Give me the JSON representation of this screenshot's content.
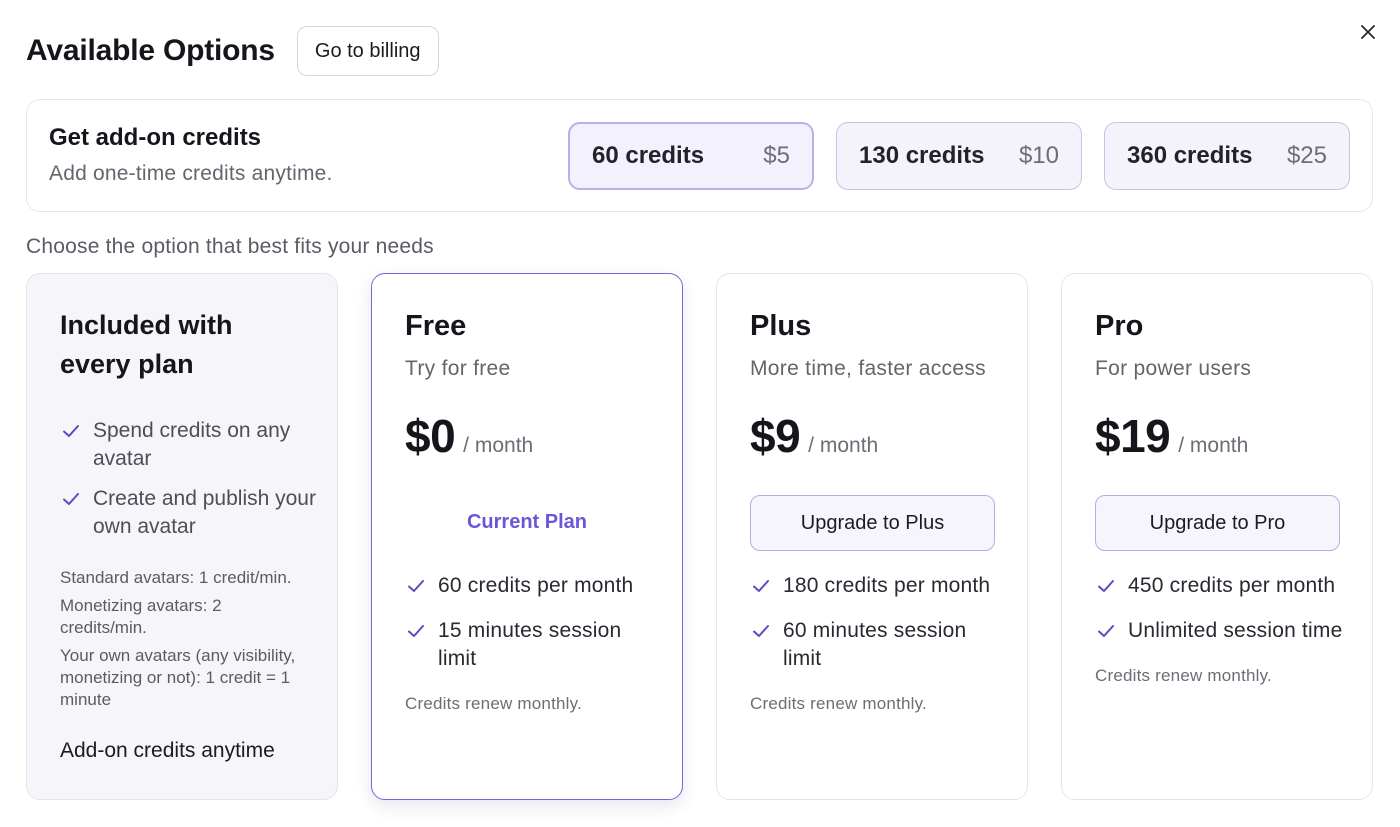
{
  "header": {
    "title": "Available Options",
    "billing_label": "Go to billing",
    "close_icon": "close-icon"
  },
  "addon": {
    "title": "Get add-on credits",
    "subtitle": "Add one-time credits anytime.",
    "options": [
      {
        "credits": "60 credits",
        "price": "$5",
        "selected": true
      },
      {
        "credits": "130 credits",
        "price": "$10",
        "selected": false
      },
      {
        "credits": "360 credits",
        "price": "$25",
        "selected": false
      }
    ]
  },
  "choose_label": "Choose the option that best fits your needs",
  "included": {
    "title": "Included with every plan",
    "items": [
      "Spend credits on any avatar",
      "Create and publish your own avatar"
    ],
    "fine_print": [
      "Standard avatars: 1 credit/min.",
      "Monetizing avatars: 2 credits/min.",
      "Your own avatars (any visibility, monetizing or not): 1 credit = 1 minute"
    ],
    "addon_label": "Add-on credits anytime"
  },
  "plans": [
    {
      "name": "Free",
      "tagline": "Try for free",
      "price": "$0",
      "period": "/ month",
      "action": "Current Plan",
      "current": true,
      "features": [
        "60 credits per month",
        "15 minutes session limit"
      ],
      "renew": "Credits renew monthly."
    },
    {
      "name": "Plus",
      "tagline": "More time, faster access",
      "price": "$9",
      "period": "/ month",
      "action": "Upgrade to Plus",
      "current": false,
      "features": [
        "180 credits per month",
        "60 minutes session limit"
      ],
      "renew": "Credits renew monthly."
    },
    {
      "name": "Pro",
      "tagline": "For power users",
      "price": "$19",
      "period": "/ month",
      "action": "Upgrade to Pro",
      "current": false,
      "features": [
        "450 credits per month",
        "Unlimited session time"
      ],
      "renew": "Credits renew monthly."
    }
  ],
  "colors": {
    "accent": "#6a57d6",
    "check": "#5b4bc4",
    "selected_border": "#b8b0ee",
    "card_border": "#e5e4ea"
  }
}
